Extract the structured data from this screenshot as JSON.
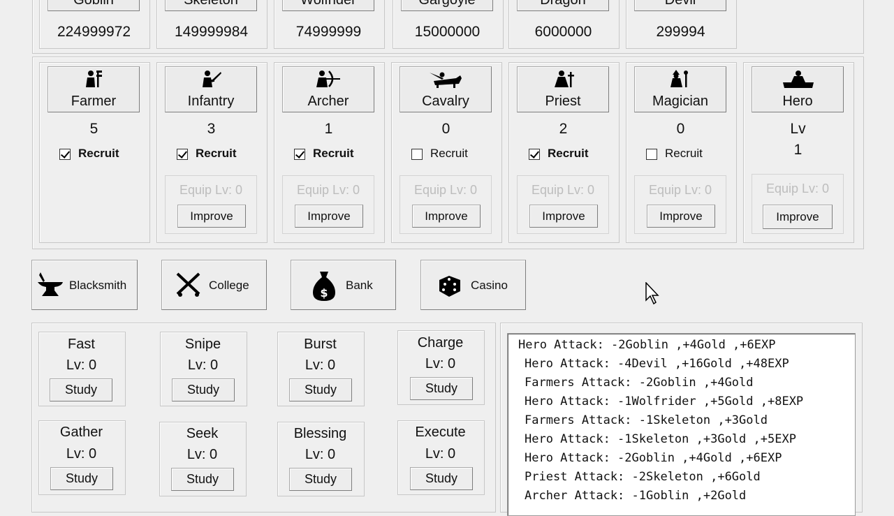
{
  "enemies": [
    {
      "name": "Goblin",
      "count": "224999972"
    },
    {
      "name": "Skeleton",
      "count": "149999984"
    },
    {
      "name": "Wolfrider",
      "count": "74999999"
    },
    {
      "name": "Gargoyle",
      "count": "15000000"
    },
    {
      "name": "Dragon",
      "count": "6000000"
    },
    {
      "name": "Devil",
      "count": "299994"
    }
  ],
  "units": [
    {
      "name": "Farmer",
      "count": "5",
      "recruit_label": "Recruit",
      "recruit": true,
      "icon": "farmer-icon"
    },
    {
      "name": "Infantry",
      "count": "3",
      "recruit_label": "Recruit",
      "recruit": true,
      "equip": "Equip Lv: 0",
      "improve": "Improve",
      "icon": "infantry-icon"
    },
    {
      "name": "Archer",
      "count": "1",
      "recruit_label": "Recruit",
      "recruit": true,
      "equip": "Equip Lv: 0",
      "improve": "Improve",
      "icon": "archer-icon"
    },
    {
      "name": "Cavalry",
      "count": "0",
      "recruit_label": "Recruit",
      "recruit": false,
      "equip": "Equip Lv: 0",
      "improve": "Improve",
      "icon": "cavalry-icon"
    },
    {
      "name": "Priest",
      "count": "2",
      "recruit_label": "Recruit",
      "recruit": true,
      "equip": "Equip Lv: 0",
      "improve": "Improve",
      "icon": "priest-icon"
    },
    {
      "name": "Magician",
      "count": "0",
      "recruit_label": "Recruit",
      "recruit": false,
      "equip": "Equip Lv: 0",
      "improve": "Improve",
      "icon": "magician-icon"
    }
  ],
  "hero": {
    "name": "Hero",
    "lv_label": "Lv",
    "lv": "1",
    "equip": "Equip Lv: 0",
    "improve": "Improve",
    "icon": "hero-icon"
  },
  "buildings": [
    {
      "label": "Blacksmith",
      "icon": "anvil-icon"
    },
    {
      "label": "College",
      "icon": "crossed-swords-icon"
    },
    {
      "label": "Bank",
      "icon": "money-bag-icon"
    },
    {
      "label": "Casino",
      "icon": "dice-icon"
    }
  ],
  "skills": [
    {
      "name": "Fast",
      "lv": "Lv: 0",
      "button": "Study"
    },
    {
      "name": "Snipe",
      "lv": "Lv: 0",
      "button": "Study"
    },
    {
      "name": "Burst",
      "lv": "Lv: 0",
      "button": "Study"
    },
    {
      "name": "Charge",
      "lv": "Lv: 0",
      "button": "Study"
    },
    {
      "name": "Gather",
      "lv": "Lv: 0",
      "button": "Study"
    },
    {
      "name": "Seek",
      "lv": "Lv: 0",
      "button": "Study"
    },
    {
      "name": "Blessing",
      "lv": "Lv: 0",
      "button": "Study"
    },
    {
      "name": "Execute",
      "lv": "Lv: 0",
      "button": "Study"
    }
  ],
  "log": [
    "Hero Attack: -2Goblin ,+4Gold ,+6EXP",
    "Hero Attack: -4Devil ,+16Gold ,+48EXP",
    "Farmers Attack: -2Goblin ,+4Gold",
    "Hero Attack: -1Wolfrider ,+5Gold ,+8EXP",
    "Farmers Attack: -1Skeleton ,+3Gold",
    "Hero Attack: -1Skeleton ,+3Gold ,+5EXP",
    "Hero Attack: -2Goblin ,+4Gold ,+6EXP",
    "Priest Attack: -2Skeleton ,+6Gold",
    "Archer Attack: -1Goblin ,+2Gold"
  ]
}
